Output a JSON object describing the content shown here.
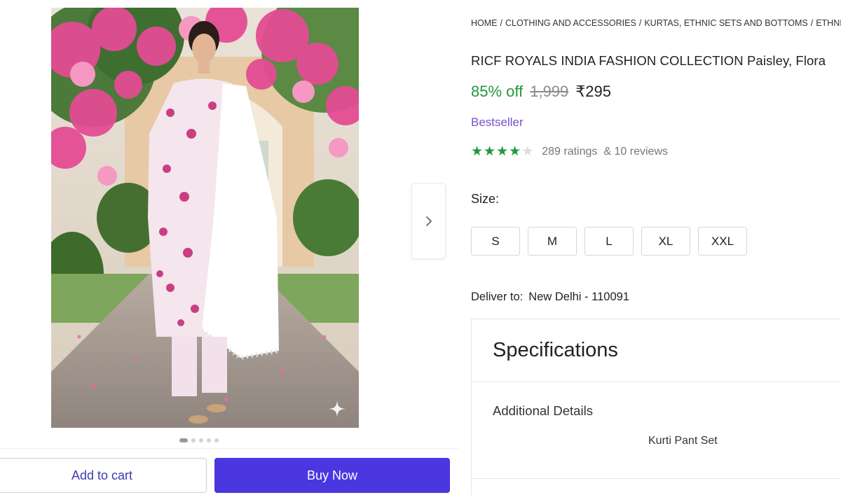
{
  "breadcrumb": [
    "HOME",
    "CLOTHING AND ACCESSORIES",
    "KURTAS, ETHNIC SETS AND BOTTOMS",
    "ETHNIC"
  ],
  "product": {
    "title": "RICF ROYALS INDIA FASHION COLLECTION Paisley, Flora",
    "discount": "85% off",
    "mrp": "1,999",
    "price": "₹295",
    "badge": "Bestseller",
    "rating_value": 4,
    "rating_max": 5,
    "ratings_count": "289 ratings",
    "reviews_count": "& 10 reviews"
  },
  "gallery": {
    "image_count": 5,
    "active_index": 0
  },
  "size": {
    "label": "Size:",
    "options": [
      "S",
      "M",
      "L",
      "XL",
      "XXL"
    ]
  },
  "delivery": {
    "label": "Deliver to:",
    "location": "New Delhi - 110091"
  },
  "specifications": {
    "heading": "Specifications",
    "subheading": "Additional Details",
    "value": "Kurti Pant Set"
  },
  "actions": {
    "add_to_cart": "Add to cart",
    "buy_now": "Buy Now"
  },
  "icons": {
    "next": "chevron-right-icon",
    "sparkle": "sparkle-icon",
    "star": "star-icon"
  },
  "colors": {
    "accent": "#4b37e0",
    "discount": "#23973b",
    "badge": "#7b4fc9",
    "star": "#23973b"
  }
}
